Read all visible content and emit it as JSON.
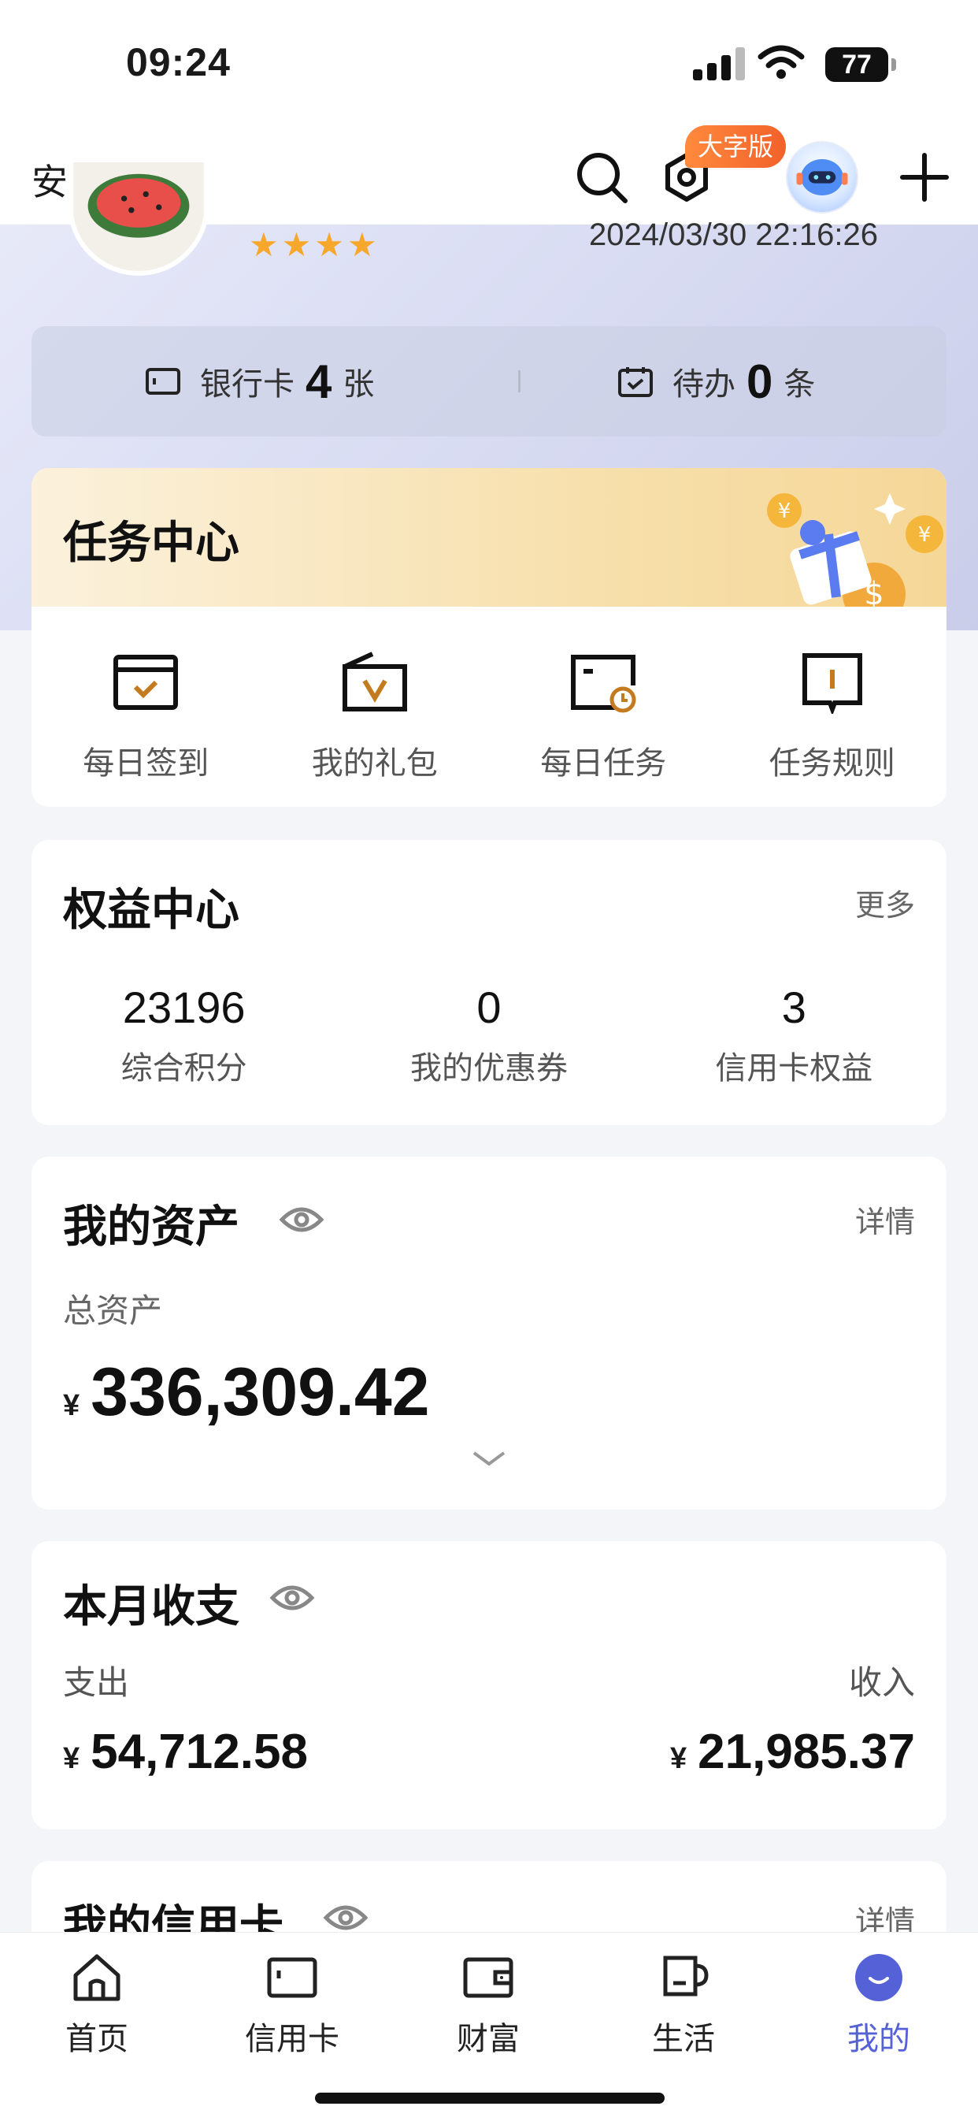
{
  "status_bar": {
    "time": "09:24",
    "battery": "77"
  },
  "header": {
    "logout_label": "安全退出",
    "large_font_badge": "大字版"
  },
  "profile": {
    "stars": "★★★★",
    "last_login": "2024/03/30 22:16:26"
  },
  "summary": {
    "cards_label": "银行卡",
    "cards_count": "4",
    "cards_unit": "张",
    "todo_label": "待办",
    "todo_count": "0",
    "todo_unit": "条"
  },
  "task_center": {
    "title": "任务中心",
    "items": [
      {
        "label": "每日签到",
        "icon": "calendar-check-icon"
      },
      {
        "label": "我的礼包",
        "icon": "gift-bag-icon"
      },
      {
        "label": "每日任务",
        "icon": "task-clock-icon"
      },
      {
        "label": "任务规则",
        "icon": "rule-book-icon"
      }
    ]
  },
  "benefits": {
    "title": "权益中心",
    "more": "更多",
    "stats": [
      {
        "value": "23196",
        "label": "综合积分"
      },
      {
        "value": "0",
        "label": "我的优惠券"
      },
      {
        "value": "3",
        "label": "信用卡权益"
      }
    ]
  },
  "assets": {
    "title": "我的资产",
    "detail": "详情",
    "total_label": "总资产",
    "currency": "¥",
    "total": "336,309.42"
  },
  "monthly": {
    "title": "本月收支",
    "expense_label": "支出",
    "expense": "54,712.58",
    "income_label": "收入",
    "income": "21,985.37",
    "currency": "¥"
  },
  "credit_cards": {
    "title": "我的信用卡",
    "detail": "详情"
  },
  "tab_bar": {
    "items": [
      {
        "label": "首页",
        "icon": "home-icon"
      },
      {
        "label": "信用卡",
        "icon": "credit-card-icon"
      },
      {
        "label": "财富",
        "icon": "wallet-icon"
      },
      {
        "label": "生活",
        "icon": "cup-icon"
      },
      {
        "label": "我的",
        "icon": "profile-icon"
      }
    ],
    "active": "我的",
    "accent": "#5561d6"
  }
}
